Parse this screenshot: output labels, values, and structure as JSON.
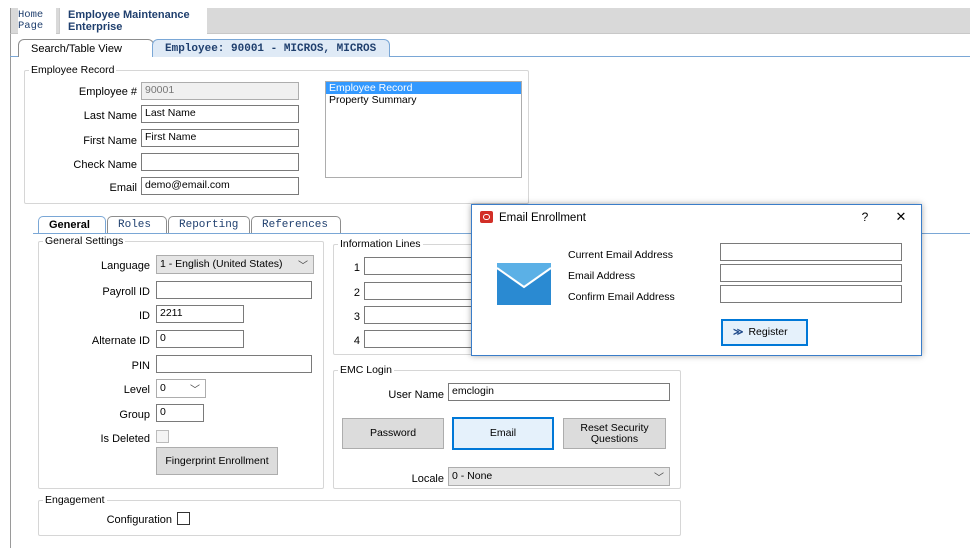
{
  "header": {
    "home_line1": "Home",
    "home_line2": "Page",
    "app_line1": "Employee Maintenance",
    "app_line2": "Enterprise"
  },
  "page_tabs": [
    {
      "label": "Search/Table View"
    },
    {
      "label": "Employee: 90001 - MICROS, MICROS"
    }
  ],
  "employee_record": {
    "legend": "Employee Record",
    "employee_no_label": "Employee #",
    "employee_no": "90001",
    "last_name_label": "Last Name",
    "last_name": "Last Name",
    "first_name_label": "First Name",
    "first_name": "First Name",
    "check_name_label": "Check Name",
    "check_name": "",
    "email_label": "Email",
    "email": "demo@email.com",
    "list_items": [
      "Employee Record",
      "Property Summary"
    ]
  },
  "sub_tabs": [
    "General",
    "Roles",
    "Reporting",
    "References"
  ],
  "general_settings": {
    "legend": "General Settings",
    "language_label": "Language",
    "language": "1 - English (United States)",
    "payroll_label": "Payroll ID",
    "payroll": "",
    "id_label": "ID",
    "id": "2211",
    "alt_id_label": "Alternate ID",
    "alt_id": "0",
    "pin_label": "PIN",
    "pin": "",
    "level_label": "Level",
    "level": "0",
    "group_label": "Group",
    "group": "0",
    "deleted_label": "Is Deleted",
    "fingerprint_btn": "Fingerprint Enrollment"
  },
  "info_lines": {
    "legend": "Information Lines",
    "nums": [
      "1",
      "2",
      "3",
      "4"
    ]
  },
  "emc_login": {
    "legend": "EMC Login",
    "user_label": "User Name",
    "user": "emclogin",
    "password_btn": "Password",
    "email_btn": "Email",
    "reset_btn_l1": "Reset Security",
    "reset_btn_l2": "Questions",
    "locale_label": "Locale",
    "locale": "0 - None"
  },
  "engagement": {
    "legend": "Engagement",
    "config_label": "Configuration"
  },
  "dialog": {
    "title": "Email Enrollment",
    "help": "?",
    "close": "✕",
    "current_label": "Current Email Address",
    "email_label": "Email Address",
    "confirm_label": "Confirm Email Address",
    "register_btn": "Register",
    "accent": "#d22f27",
    "envelope_color": "#2a8ad2"
  }
}
